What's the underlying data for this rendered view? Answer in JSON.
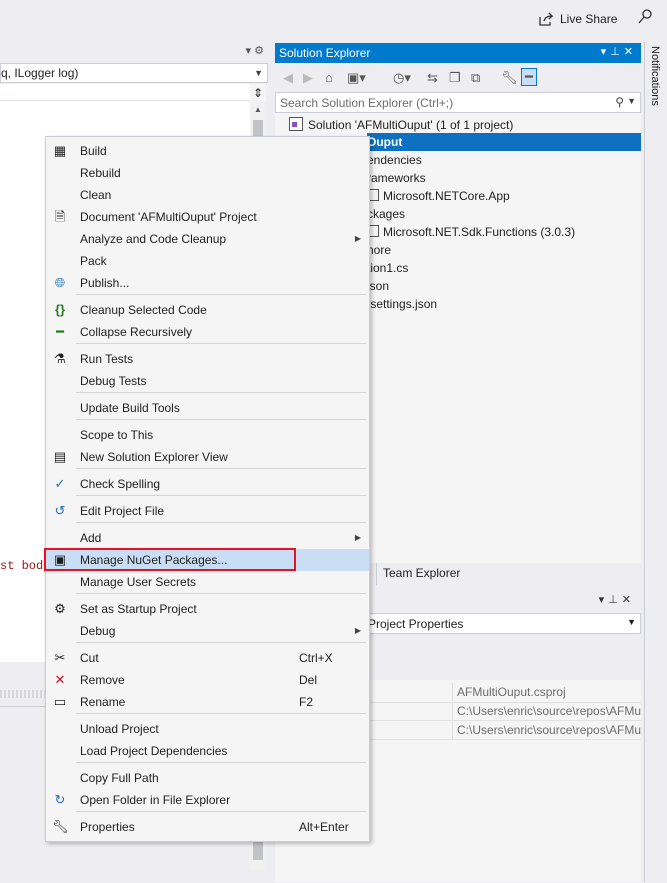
{
  "topbar": {
    "live_share": "Live Share"
  },
  "notifications": {
    "label": "Notifications"
  },
  "editor": {
    "nav_combo": "q, ILogger log)",
    "code_fragment": "st body"
  },
  "solution_explorer": {
    "title": "Solution Explorer",
    "search_placeholder": "Search Solution Explorer (Ctrl+;)",
    "tree": [
      "Solution 'AFMultiOuput' (1 of 1 project)",
      "Ouput",
      "endencies",
      "rameworks",
      "Microsoft.NETCore.App",
      "ckages",
      "Microsoft.NET.Sdk.Functions (3.0.3)",
      "nore",
      "tion1.cs",
      "json",
      ".settings.json"
    ],
    "team_tab": "Team Explorer"
  },
  "properties": {
    "combo": "Project Properties",
    "values": [
      "AFMultiOuput.csproj",
      "C:\\Users\\enric\\source\\repos\\AFMu",
      "C:\\Users\\enric\\source\\repos\\AFMu"
    ]
  },
  "menu": {
    "items": [
      {
        "label": "Build",
        "icon": "build-icon"
      },
      {
        "label": "Rebuild"
      },
      {
        "label": "Clean"
      },
      {
        "label": "Document 'AFMultiOuput' Project",
        "icon": "document-icon"
      },
      {
        "label": "Analyze and Code Cleanup",
        "submenu": true
      },
      {
        "label": "Pack"
      },
      {
        "label": "Publish...",
        "icon": "globe-icon"
      },
      {
        "label": "Cleanup Selected Code",
        "icon": "braces-icon"
      },
      {
        "label": "Collapse Recursively",
        "icon": "collapse-icon"
      },
      {
        "label": "Run Tests",
        "icon": "flask-icon"
      },
      {
        "label": "Debug Tests"
      },
      {
        "label": "Update Build Tools"
      },
      {
        "label": "Scope to This"
      },
      {
        "label": "New Solution Explorer View",
        "icon": "window-icon"
      },
      {
        "label": "Check Spelling",
        "icon": "spellcheck-icon"
      },
      {
        "label": "Edit Project File",
        "icon": "edit-icon"
      },
      {
        "label": "Add",
        "submenu": true
      },
      {
        "label": "Manage NuGet Packages...",
        "icon": "nuget-icon"
      },
      {
        "label": "Manage User Secrets"
      },
      {
        "label": "Set as Startup Project",
        "icon": "gear-icon"
      },
      {
        "label": "Debug",
        "submenu": true
      },
      {
        "label": "Cut",
        "shortcut": "Ctrl+X",
        "icon": "scissors-icon"
      },
      {
        "label": "Remove",
        "shortcut": "Del",
        "icon": "remove-icon"
      },
      {
        "label": "Rename",
        "shortcut": "F2",
        "icon": "rename-icon"
      },
      {
        "label": "Unload Project"
      },
      {
        "label": "Load Project Dependencies"
      },
      {
        "label": "Copy Full Path"
      },
      {
        "label": "Open Folder in File Explorer",
        "icon": "refresh-arrow-icon"
      },
      {
        "label": "Properties",
        "shortcut": "Alt+Enter",
        "icon": "wrench-icon"
      }
    ]
  },
  "colors": {
    "accent": "#007acc",
    "selection": "#0e70c0",
    "highlight": "#c9def5",
    "annotation_box": "#e81123"
  }
}
